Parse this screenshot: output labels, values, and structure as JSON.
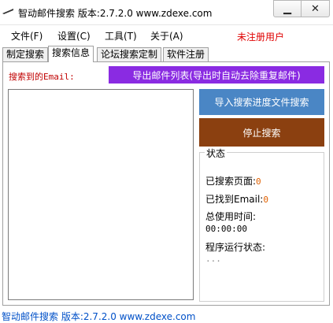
{
  "window": {
    "title": "智动邮件搜索 版本:2.7.2.0 www.zdexe.com",
    "min_symbol": "▁",
    "close_symbol": "✕"
  },
  "menu": {
    "items": [
      "文件(F)",
      "设置(C)",
      "工具(T)",
      "关于(A)"
    ],
    "user_status": "未注册用户",
    "user_status_color": "#e00000"
  },
  "tabs": {
    "items": [
      "制定搜索",
      "搜索信息",
      "论坛搜索定制",
      "软件注册"
    ],
    "active": "搜索信息"
  },
  "main": {
    "email_label": "搜索到的Email:",
    "export_button": "导出邮件列表(导出时自动去除重复邮件)",
    "import_button": "导入搜索进度文件搜索",
    "stop_button": "停止搜索"
  },
  "status": {
    "title": "状态",
    "pages_label": "已搜索页面:",
    "pages_value": "0",
    "emails_label": "已找到Email:",
    "emails_value": "0",
    "time_label": "总使用时间:",
    "time_value": "00:00:00",
    "run_label": "程序运行状态:",
    "run_value": "..."
  },
  "statusbar": {
    "text": "智动邮件搜索 版本:2.7.2.0 www.zdexe.com"
  },
  "colors": {
    "export_button": "#8a2be2",
    "import_button": "#4a86c5",
    "stop_button": "#8b4010",
    "status_value": "#e06000",
    "statusbar_text": "#0050c8"
  }
}
